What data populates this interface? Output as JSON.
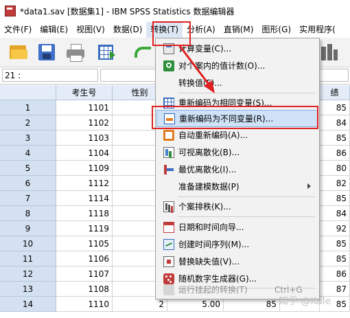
{
  "window": {
    "title": "*data1.sav [数据集1] - IBM SPSS Statistics 数据编辑器"
  },
  "menubar": {
    "items": [
      "文件(F)",
      "编辑(E)",
      "视图(V)",
      "数据(D)",
      "转换(T)",
      "分析(A)",
      "直销(M)",
      "图形(G)",
      "实用程序("
    ],
    "active": "转换(T)"
  },
  "cellbar": {
    "cell_ref": "21 :",
    "value": ""
  },
  "grid": {
    "headers": [
      "",
      "考生号",
      "性别",
      "绩"
    ],
    "rows": [
      {
        "n": "1",
        "id": "1101",
        "score": "85"
      },
      {
        "n": "2",
        "id": "1102",
        "score": "84"
      },
      {
        "n": "3",
        "id": "1103",
        "score": "85"
      },
      {
        "n": "4",
        "id": "1104",
        "score": "86"
      },
      {
        "n": "5",
        "id": "1109",
        "score": "80"
      },
      {
        "n": "6",
        "id": "1112",
        "score": "82"
      },
      {
        "n": "7",
        "id": "1114",
        "score": "85"
      },
      {
        "n": "8",
        "id": "1118",
        "score": "84"
      },
      {
        "n": "9",
        "id": "1119",
        "score": "92"
      },
      {
        "n": "10",
        "id": "1105",
        "score": "85"
      },
      {
        "n": "11",
        "id": "1106",
        "score": "85"
      },
      {
        "n": "12",
        "id": "1107",
        "score": "86"
      },
      {
        "n": "13",
        "id": "1108",
        "score": "87"
      },
      {
        "n": "14",
        "id": "1110",
        "gender": "2",
        "col3": "5.00",
        "col4": "85",
        "score": "85"
      }
    ]
  },
  "transform_menu": {
    "items": [
      {
        "icon": "calculator-icon",
        "label": "计算变量(C)...",
        "enabled": true
      },
      {
        "icon": "count-values-icon",
        "label": "对个案内的值计数(O)...",
        "enabled": true
      },
      {
        "icon": "",
        "label": "转换值(F)...",
        "enabled": true
      },
      {
        "icon": "recode-same-icon",
        "label": "重新编码为相同变量(S)...",
        "enabled": true
      },
      {
        "icon": "recode-different-icon",
        "label": "重新编码为不同变量(R)...",
        "enabled": true,
        "selected": true
      },
      {
        "icon": "auto-recode-icon",
        "label": "自动重新编码(A)...",
        "enabled": true
      },
      {
        "icon": "visual-binning-icon",
        "label": "可视离散化(B)...",
        "enabled": true
      },
      {
        "icon": "optimal-binning-icon",
        "label": "最优离散化(I)...",
        "enabled": true
      },
      {
        "icon": "",
        "label": "准备建模数据(P)",
        "enabled": true,
        "submenu": true
      },
      {
        "icon": "rank-cases-icon",
        "label": "个案排秩(K)...",
        "enabled": true
      },
      {
        "icon": "date-time-icon",
        "label": "日期和时间向导...",
        "enabled": true
      },
      {
        "icon": "time-series-icon",
        "label": "创建时间序列(M)...",
        "enabled": true
      },
      {
        "icon": "replace-missing-icon",
        "label": "替换缺失值(V)...",
        "enabled": true
      },
      {
        "icon": "random-generator-icon",
        "label": "随机数字生成器(G)...",
        "enabled": true
      },
      {
        "icon": "pending-transform-icon",
        "label": "运行挂起的转换(T)",
        "enabled": false,
        "shortcut": "Ctrl+G"
      }
    ]
  },
  "watermark": "知乎 @Kule",
  "colors": {
    "annotation_red": "#e02020",
    "header_blue": "#e3ecf7",
    "row_number_blue": "#d4e1f1"
  }
}
